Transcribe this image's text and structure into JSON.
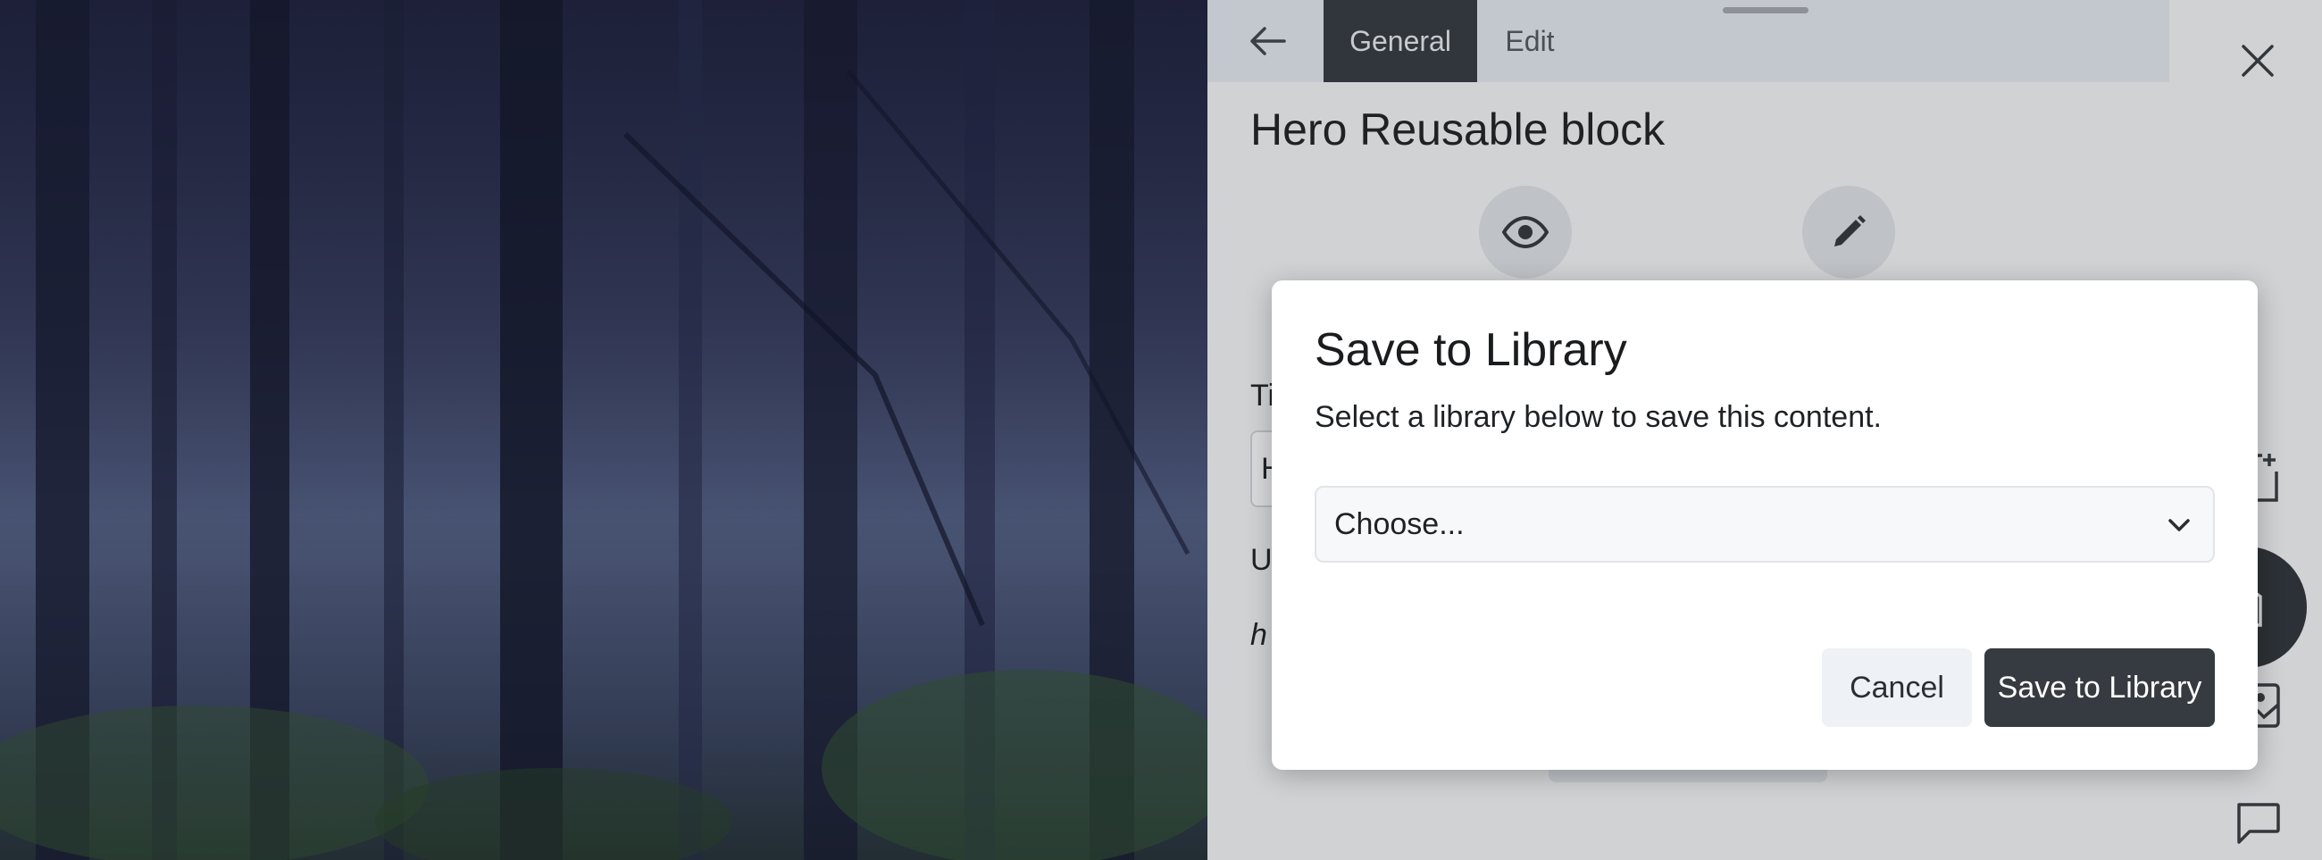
{
  "panel": {
    "tabs": [
      {
        "label": "General",
        "active": true
      },
      {
        "label": "Edit",
        "active": false
      }
    ],
    "title": "Hero Reusable block",
    "icons": {
      "back": "arrow-left-icon",
      "view": "eye-icon",
      "edit": "pencil-icon"
    },
    "peek": {
      "title_label": "Ti",
      "title_value": "H",
      "url_label": "U",
      "url_value": "h"
    }
  },
  "rail": {
    "icons": [
      "close-icon",
      "new-page-icon",
      "library-icon",
      "image-icon",
      "comment-icon"
    ]
  },
  "dialog": {
    "title": "Save to Library",
    "description": "Select a library below to save this content.",
    "select": {
      "value": "Choose..."
    },
    "cancel_label": "Cancel",
    "save_label": "Save to Library"
  },
  "colors": {
    "panel_bg": "#d1d2d4",
    "active_tab": "#30363b",
    "primary_button": "#353b40",
    "secondary_button": "#eef1f5"
  }
}
